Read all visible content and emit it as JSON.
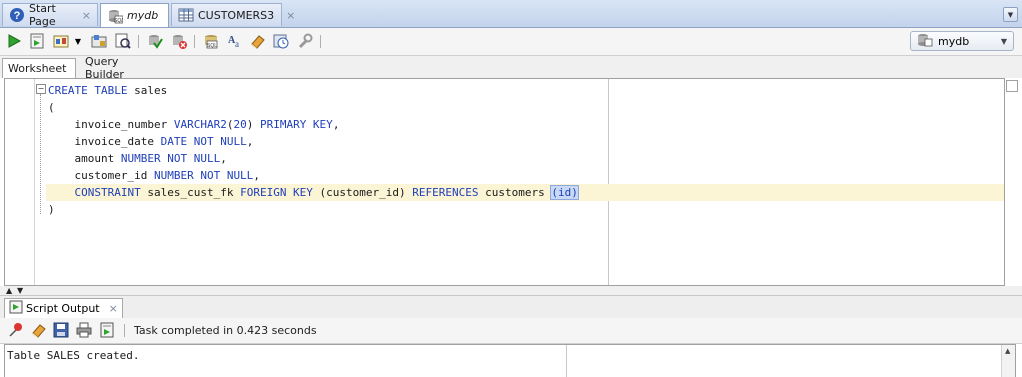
{
  "doc_tabs": [
    {
      "label": "Start Page",
      "icon": "help-icon"
    },
    {
      "label": "mydb",
      "icon": "sql-worksheet-icon"
    },
    {
      "label": "CUSTOMERS3",
      "icon": "table-grid-icon"
    }
  ],
  "tab_close_glyph": "×",
  "toolbar": {
    "buttons": [
      "run-statement-icon",
      "run-script-icon",
      "autotrace-icon",
      "explain-plan-icon",
      "sql-tuning-icon",
      "commit-icon",
      "rollback-icon",
      "unshared-sql-icon",
      "to-upper-lower-icon",
      "clear-icon",
      "sql-history-icon",
      "tools-icon"
    ],
    "connection": "mydb"
  },
  "sub_tabs": [
    "Worksheet",
    "Query Builder"
  ],
  "editor": {
    "lines": [
      [
        {
          "t": "CREATE TABLE",
          "k": true
        },
        {
          "t": " sales"
        }
      ],
      [
        {
          "t": "("
        }
      ],
      [
        {
          "t": "    invoice_number "
        },
        {
          "t": "VARCHAR2",
          "k": true
        },
        {
          "t": "("
        },
        {
          "t": "20",
          "k": true
        },
        {
          "t": ") "
        },
        {
          "t": "PRIMARY KEY",
          "k": true
        },
        {
          "t": ","
        }
      ],
      [
        {
          "t": "    invoice_date "
        },
        {
          "t": "DATE NOT NULL",
          "k": true
        },
        {
          "t": ","
        }
      ],
      [
        {
          "t": "    amount "
        },
        {
          "t": "NUMBER NOT NULL",
          "k": true
        },
        {
          "t": ","
        }
      ],
      [
        {
          "t": "    customer_id "
        },
        {
          "t": "NUMBER NOT NULL",
          "k": true
        },
        {
          "t": ","
        }
      ],
      [
        {
          "t": "    "
        },
        {
          "t": "CONSTRAINT",
          "k": true
        },
        {
          "t": " sales_cust_fk "
        },
        {
          "t": "FOREIGN KEY",
          "k": true
        },
        {
          "t": " (customer_id) "
        },
        {
          "t": "REFERENCES",
          "k": true
        },
        {
          "t": " customers "
        },
        {
          "t": "(id)",
          "k": true,
          "hl": true
        }
      ],
      [
        {
          "t": ")"
        }
      ]
    ],
    "current_line": 6
  },
  "output_panel": {
    "tab_label": "Script Output",
    "toolbar_buttons": [
      "pin-icon",
      "eraser-icon",
      "save-icon",
      "print-icon",
      "open-file-icon"
    ],
    "status": "Task completed in 0.423 seconds",
    "text": "Table SALES created."
  }
}
